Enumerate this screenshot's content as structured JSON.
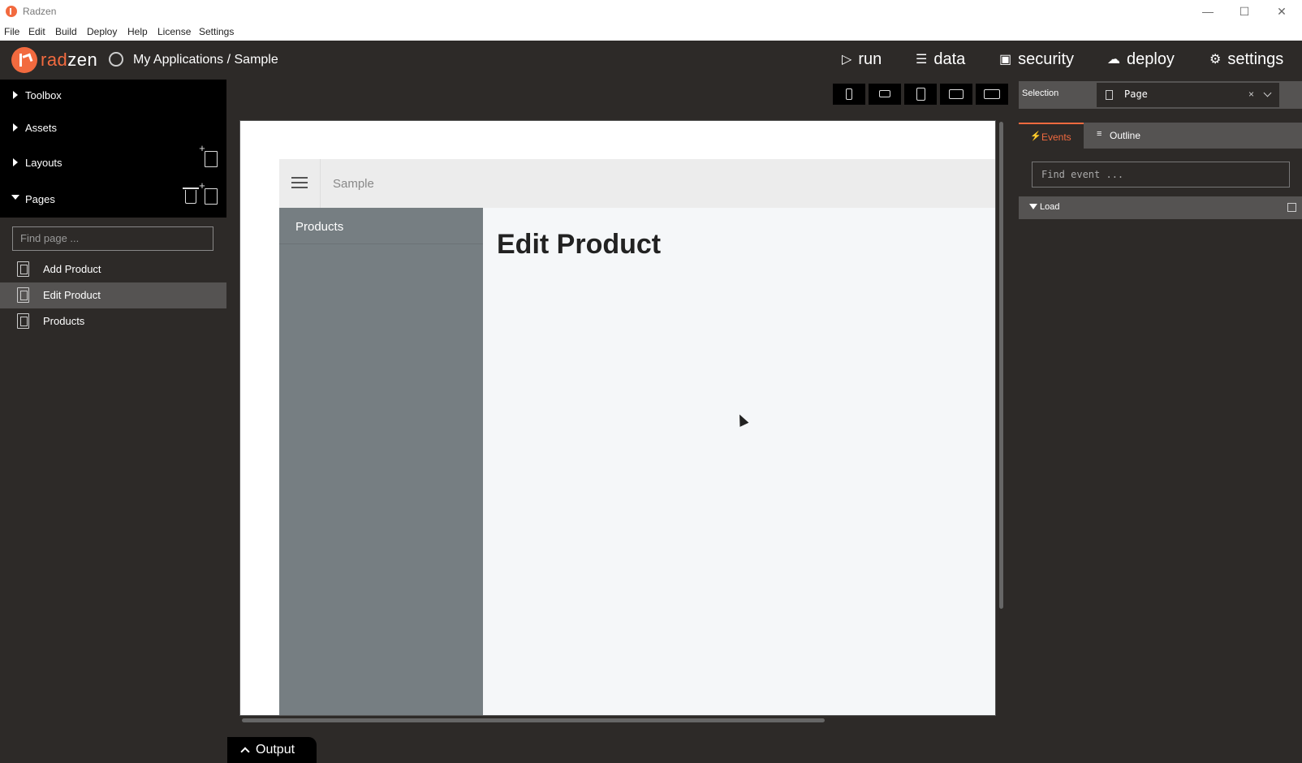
{
  "window": {
    "title": "Radzen",
    "controls": [
      "minimize-icon",
      "maximize-icon",
      "close-icon"
    ]
  },
  "menu": [
    "File",
    "Edit",
    "Build",
    "Deploy",
    "Help",
    "License",
    "Settings"
  ],
  "header": {
    "brand_prefix": "rad",
    "brand_suffix": "zen",
    "breadcrumb": "My Applications / Sample",
    "nav": [
      {
        "label": "run",
        "icon": "play-icon"
      },
      {
        "label": "data",
        "icon": "layers-icon"
      },
      {
        "label": "security",
        "icon": "lock-icon"
      },
      {
        "label": "deploy",
        "icon": "cloud-upload-icon"
      },
      {
        "label": "settings",
        "icon": "gear-icon"
      }
    ]
  },
  "sidebar": {
    "sections": [
      {
        "label": "Toolbox",
        "expanded": false
      },
      {
        "label": "Assets",
        "expanded": false
      },
      {
        "label": "Layouts",
        "expanded": false
      },
      {
        "label": "Pages",
        "expanded": true
      }
    ],
    "find_page_placeholder": "Find page ...",
    "pages": [
      {
        "label": "Add Product",
        "active": false
      },
      {
        "label": "Edit Product",
        "active": true
      },
      {
        "label": "Products",
        "active": false
      }
    ]
  },
  "device_buttons": [
    "phone-portrait-icon",
    "phone-landscape-icon",
    "tablet-portrait-icon",
    "laptop-icon",
    "desktop-icon"
  ],
  "canvas": {
    "app_title": "Sample",
    "nav_item": "Products",
    "heading": "Edit Product"
  },
  "output": {
    "label": "Output"
  },
  "right_panel": {
    "selection_label": "Selection",
    "selection_value": "Page",
    "clear": "×",
    "tabs": [
      {
        "label": "Events",
        "icon": "bolt-icon",
        "active": true
      },
      {
        "label": "Outline",
        "icon": "outline-icon",
        "active": false
      }
    ],
    "find_event_placeholder": "Find event ...",
    "events": [
      {
        "label": "Load"
      }
    ]
  },
  "colors": {
    "accent": "#f26a3f",
    "background": "#2d2a28",
    "panel": "#555352"
  }
}
